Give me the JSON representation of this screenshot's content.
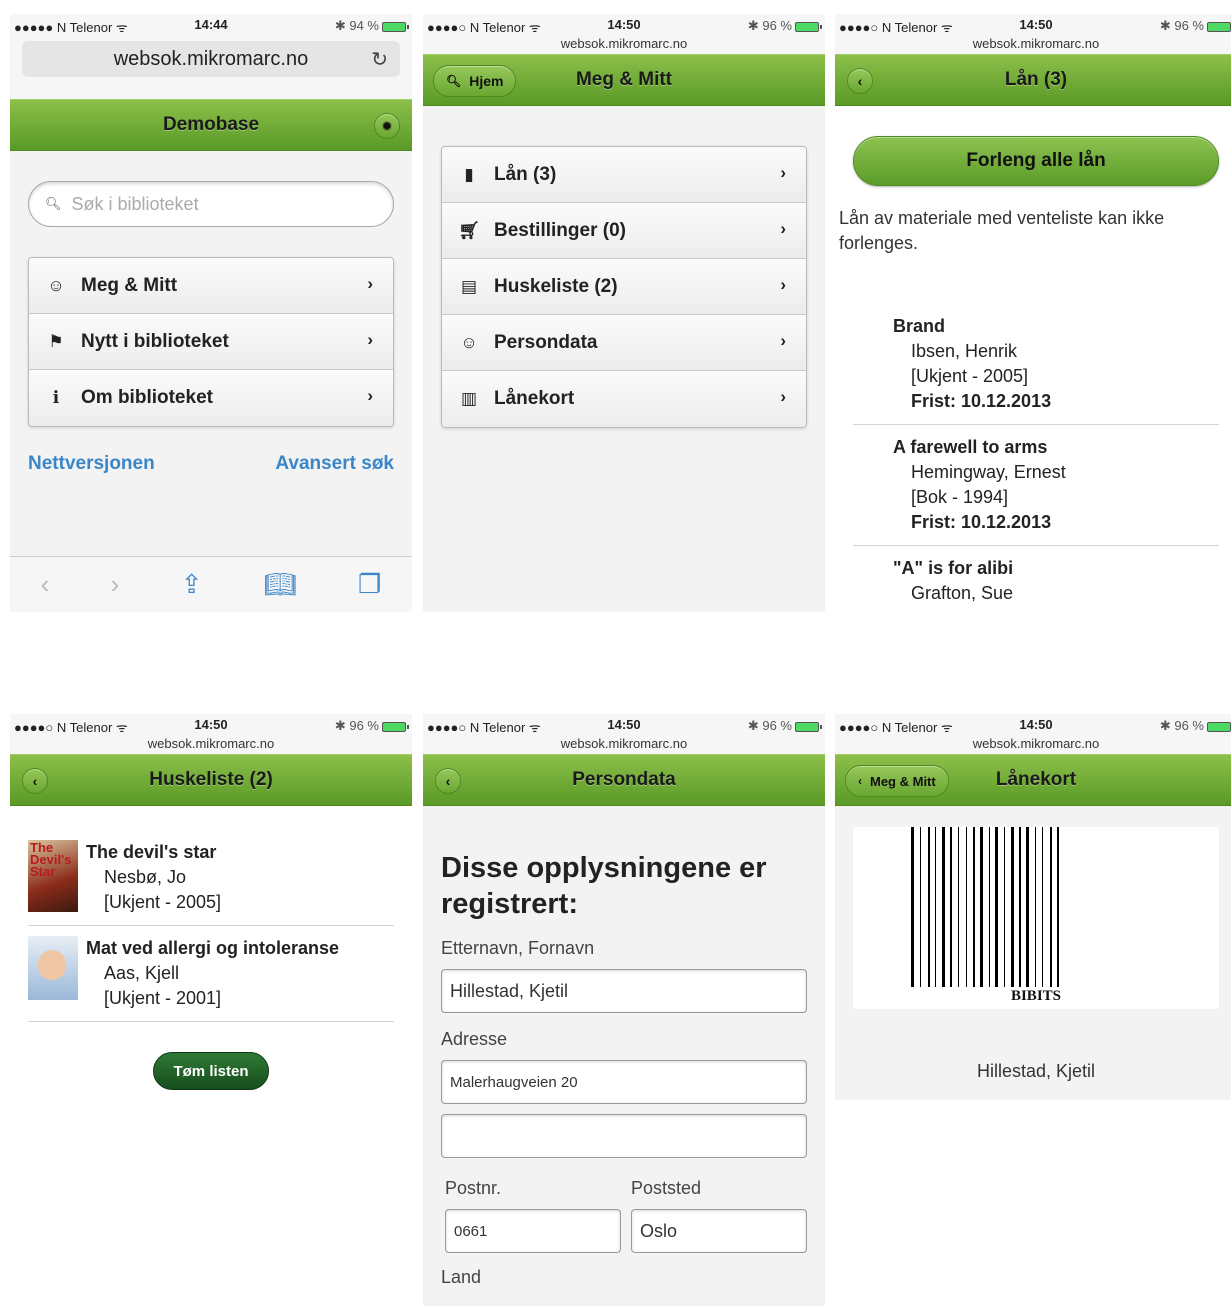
{
  "screens": {
    "home": {
      "status": {
        "carrier": "●●●●● N Telenor ᯤ",
        "time": "14:44",
        "battery": "✱ 94 %"
      },
      "url": "websok.mikromarc.no",
      "header": "Demobase",
      "search_placeholder": "Søk i biblioteket",
      "menu": [
        "Meg & Mitt",
        "Nytt i biblioteket",
        "Om biblioteket"
      ],
      "links": {
        "left": "Nettversjonen",
        "right": "Avansert søk"
      }
    },
    "meg": {
      "status": {
        "carrier": "●●●●○ N Telenor ᯤ",
        "time": "14:50",
        "battery": "✱ 96 %"
      },
      "url": "websok.mikromarc.no",
      "back_label": "Hjem",
      "header": "Meg & Mitt",
      "menu": [
        "Lån (3)",
        "Bestillinger (0)",
        "Huskeliste (2)",
        "Persondata",
        "Lånekort"
      ]
    },
    "loans": {
      "status": {
        "carrier": "●●●●○ N Telenor ᯤ",
        "time": "14:50",
        "battery": "✱ 96 %"
      },
      "url": "websok.mikromarc.no",
      "header": "Lån (3)",
      "renew_button": "Forleng alle lån",
      "note": "Lån av materiale med venteliste kan ikke forlenges.",
      "items": [
        {
          "title": "Brand",
          "author": "Ibsen, Henrik",
          "info": "[Ukjent - 2005]",
          "due": "Frist: 10.12.2013"
        },
        {
          "title": "A farewell to arms",
          "author": "Hemingway, Ernest",
          "info": "[Bok - 1994]",
          "due": "Frist: 10.12.2013"
        },
        {
          "title": "\"A\" is for alibi",
          "author": "Grafton, Sue"
        }
      ]
    },
    "wishlist": {
      "status": {
        "carrier": "●●●●○ N Telenor ᯤ",
        "time": "14:50",
        "battery": "✱ 96 %"
      },
      "url": "websok.mikromarc.no",
      "header": "Huskeliste (2)",
      "items": [
        {
          "title": "The devil's star",
          "author": "Nesbø, Jo",
          "info": "[Ukjent - 2005]",
          "cover_text": "The Devil's Star"
        },
        {
          "title": "Mat ved allergi og intoleranse",
          "author": "Aas, Kjell",
          "info": "[Ukjent - 2001]"
        }
      ],
      "clear_button": "Tøm listen"
    },
    "persondata": {
      "status": {
        "carrier": "●●●●○ N Telenor ᯤ",
        "time": "14:50",
        "battery": "✱ 96 %"
      },
      "url": "websok.mikromarc.no",
      "header": "Persondata",
      "heading": "Disse opplysningene er registrert:",
      "name_label": "Etternavn, Fornavn",
      "name_value": "Hillestad, Kjetil",
      "address_label": "Adresse",
      "address1": "Malerhaugveien 20",
      "address2": "",
      "zip_label": "Postnr.",
      "zip_value": "0661",
      "city_label": "Poststed",
      "city_value": "Oslo",
      "country_label": "Land"
    },
    "card": {
      "status": {
        "carrier": "●●●●○ N Telenor ᯤ",
        "time": "14:50",
        "battery": "✱ 96 %"
      },
      "url": "websok.mikromarc.no",
      "back_label": "Meg & Mitt",
      "header": "Lånekort",
      "barcode_text": "BIBITS",
      "owner": "Hillestad, Kjetil"
    }
  },
  "colors": {
    "header_green": "#6aa632",
    "link_blue": "#3a86c8",
    "dark_green_button": "#1f5f27"
  },
  "icons": {
    "back": "chevron-left-icon",
    "chevron": "chevron-right-icon",
    "settings": "gear-icon"
  }
}
